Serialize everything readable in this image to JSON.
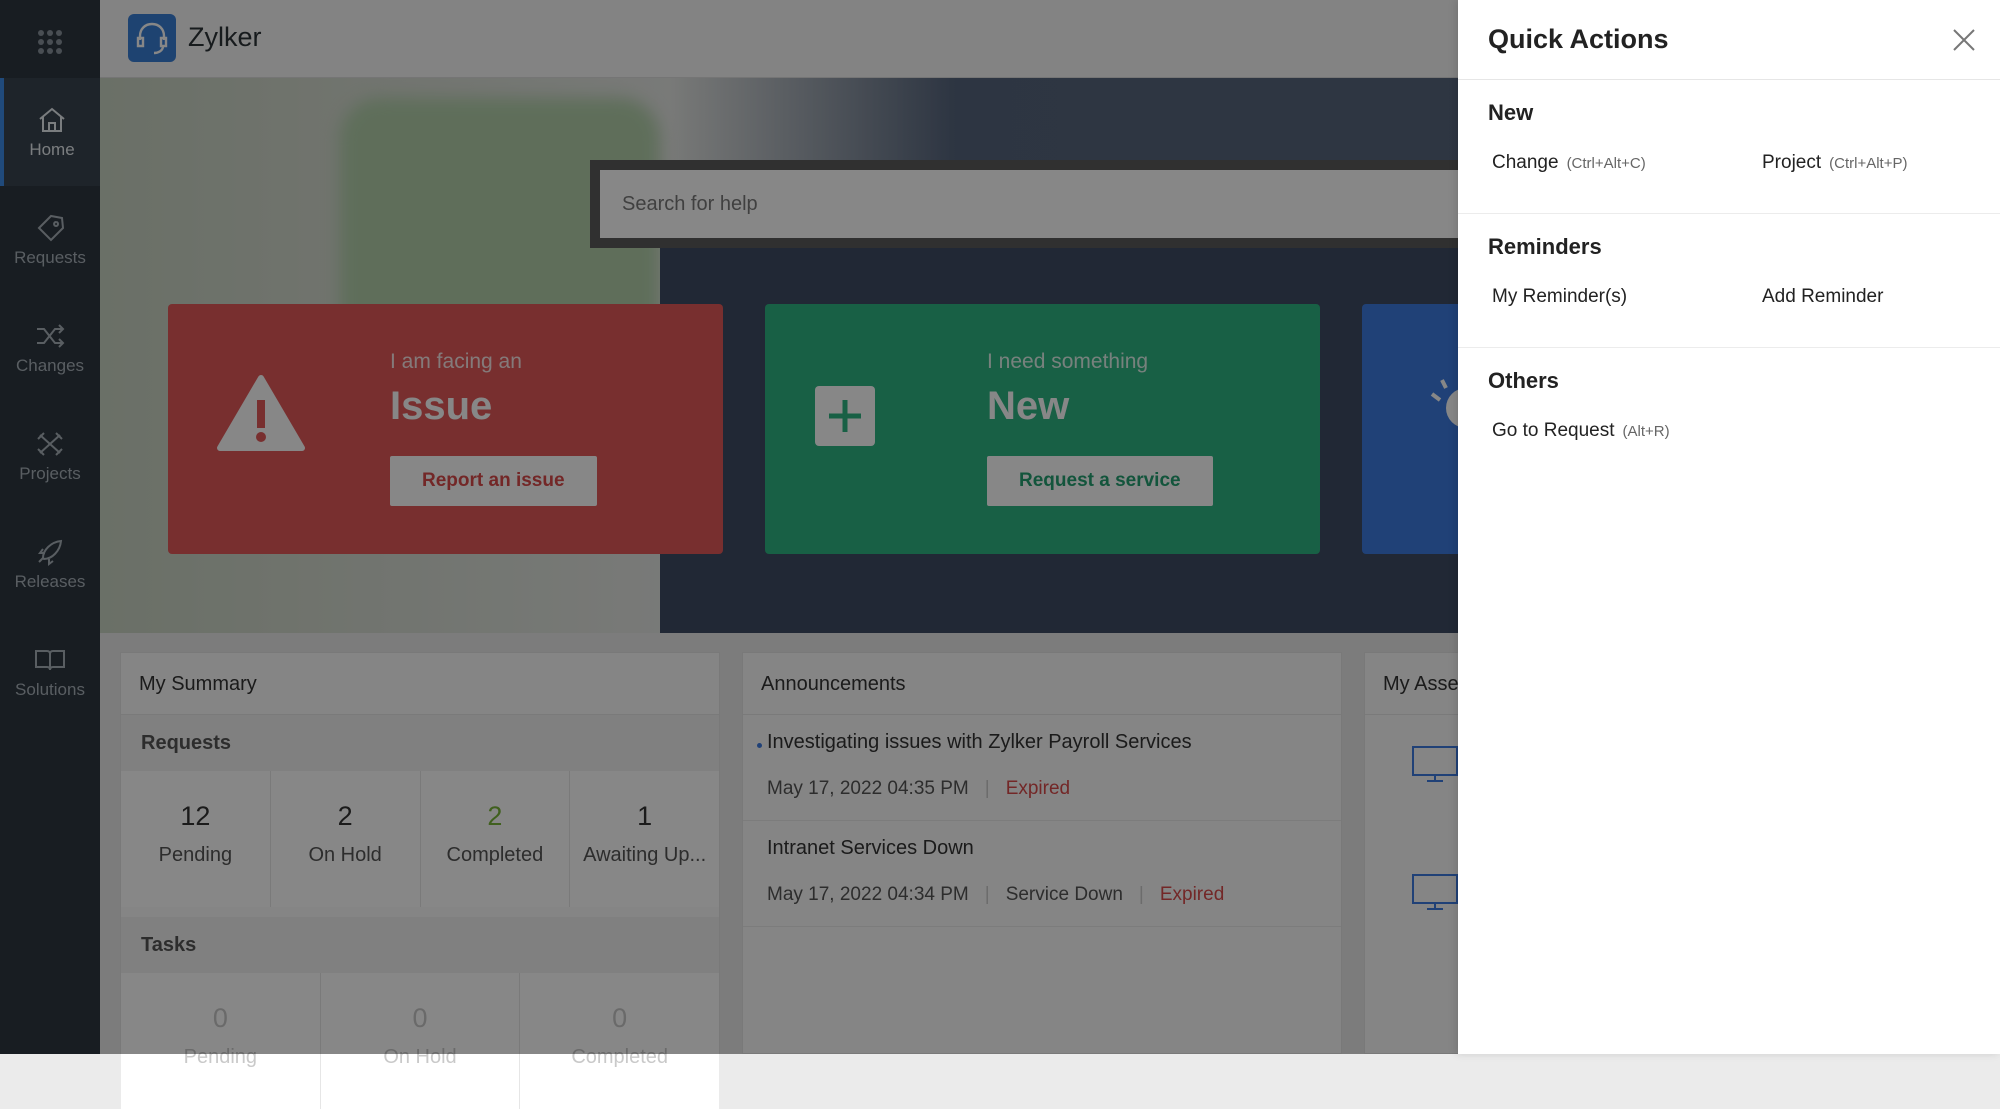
{
  "app": {
    "brand": "Zylker"
  },
  "nav": [
    {
      "label": "Home",
      "icon": "home-icon"
    },
    {
      "label": "Requests",
      "icon": "tag-icon"
    },
    {
      "label": "Changes",
      "icon": "shuffle-icon"
    },
    {
      "label": "Projects",
      "icon": "projects-icon"
    },
    {
      "label": "Releases",
      "icon": "rocket-icon"
    },
    {
      "label": "Solutions",
      "icon": "book-icon"
    }
  ],
  "search": {
    "placeholder": "Search for help"
  },
  "cards": {
    "issue": {
      "kicker": "I am facing an",
      "title": "Issue",
      "cta": "Report an issue"
    },
    "new": {
      "kicker": "I need something",
      "title": "New",
      "cta": "Request a service"
    }
  },
  "summary": {
    "title": "My Summary",
    "requests_label": "Requests",
    "requests": [
      {
        "count": "12",
        "label": "Pending"
      },
      {
        "count": "2",
        "label": "On Hold"
      },
      {
        "count": "2",
        "label": "Completed"
      },
      {
        "count": "1",
        "label": "Awaiting Up..."
      }
    ],
    "tasks_label": "Tasks",
    "tasks": [
      {
        "count": "0",
        "label": "Pending"
      },
      {
        "count": "0",
        "label": "On Hold"
      },
      {
        "count": "0",
        "label": "Completed"
      }
    ]
  },
  "announcements": {
    "title": "Announcements",
    "items": [
      {
        "title": "Investigating issues with Zylker Payroll Services",
        "date": "May 17, 2022 04:35 PM",
        "status": "Expired"
      },
      {
        "title": "Intranet Services Down",
        "date": "May 17, 2022 04:34 PM",
        "category": "Service Down",
        "status": "Expired"
      }
    ]
  },
  "assets": {
    "title": "My Asse"
  },
  "quick_actions": {
    "title": "Quick Actions",
    "sections": [
      {
        "heading": "New",
        "items": [
          {
            "label": "Change",
            "shortcut": "(Ctrl+Alt+C)"
          },
          {
            "label": "Project",
            "shortcut": "(Ctrl+Alt+P)"
          }
        ]
      },
      {
        "heading": "Reminders",
        "items": [
          {
            "label": "My Reminder(s)"
          },
          {
            "label": "Add Reminder"
          }
        ]
      },
      {
        "heading": "Others",
        "items": [
          {
            "label": "Go to Request",
            "shortcut": "(Alt+R)"
          }
        ]
      }
    ]
  },
  "colors": {
    "accent": "#3d7be0",
    "issue_card": "#e25a5a",
    "new_card": "#2fb582",
    "expired": "#d94b4b"
  }
}
